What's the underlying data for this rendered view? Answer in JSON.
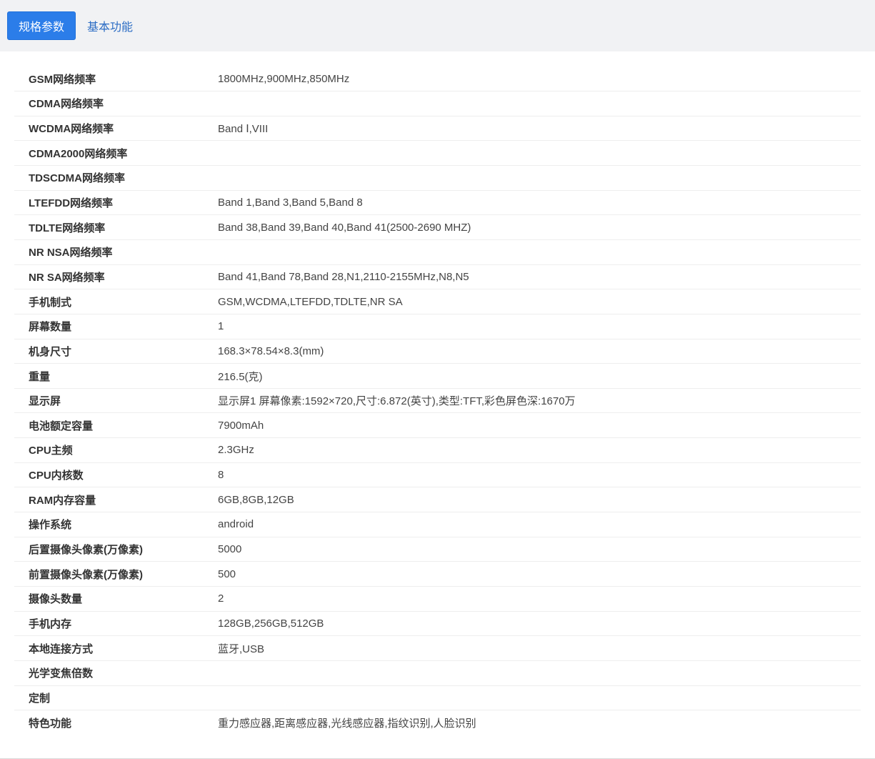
{
  "tabs": [
    {
      "label": "规格参数",
      "active": true
    },
    {
      "label": "基本功能",
      "active": false
    }
  ],
  "specs": [
    {
      "key": "GSM网络频率",
      "value": "1800MHz,900MHz,850MHz"
    },
    {
      "key": "CDMA网络频率",
      "value": ""
    },
    {
      "key": "WCDMA网络频率",
      "value": "Band Ⅰ,VIII"
    },
    {
      "key": "CDMA2000网络频率",
      "value": ""
    },
    {
      "key": "TDSCDMA网络频率",
      "value": ""
    },
    {
      "key": "LTEFDD网络频率",
      "value": "Band 1,Band 3,Band 5,Band 8"
    },
    {
      "key": "TDLTE网络频率",
      "value": "Band 38,Band 39,Band 40,Band 41(2500-2690 MHZ)"
    },
    {
      "key": "NR NSA网络频率",
      "value": ""
    },
    {
      "key": "NR SA网络频率",
      "value": "Band 41,Band 78,Band 28,N1,2110-2155MHz,N8,N5"
    },
    {
      "key": "手机制式",
      "value": "GSM,WCDMA,LTEFDD,TDLTE,NR SA"
    },
    {
      "key": "屏幕数量",
      "value": "1"
    },
    {
      "key": "机身尺寸",
      "value": "168.3×78.54×8.3(mm)"
    },
    {
      "key": "重量",
      "value": "216.5(克)"
    },
    {
      "key": "显示屏",
      "value": "显示屏1 屏幕像素:1592×720,尺寸:6.872(英寸),类型:TFT,彩色屏色深:1670万"
    },
    {
      "key": "电池额定容量",
      "value": "7900mAh"
    },
    {
      "key": "CPU主频",
      "value": "2.3GHz"
    },
    {
      "key": "CPU内核数",
      "value": "8"
    },
    {
      "key": "RAM内存容量",
      "value": "6GB,8GB,12GB"
    },
    {
      "key": "操作系统",
      "value": "android"
    },
    {
      "key": "后置摄像头像素(万像素)",
      "value": "5000"
    },
    {
      "key": "前置摄像头像素(万像素)",
      "value": "500"
    },
    {
      "key": "摄像头数量",
      "value": "2"
    },
    {
      "key": "手机内存",
      "value": "128GB,256GB,512GB"
    },
    {
      "key": "本地连接方式",
      "value": "蓝牙,USB"
    },
    {
      "key": "光学变焦倍数",
      "value": ""
    },
    {
      "key": "定制",
      "value": ""
    },
    {
      "key": "特色功能",
      "value": "重力感应器,距离感应器,光线感应器,指纹识别,人脸识别"
    }
  ]
}
